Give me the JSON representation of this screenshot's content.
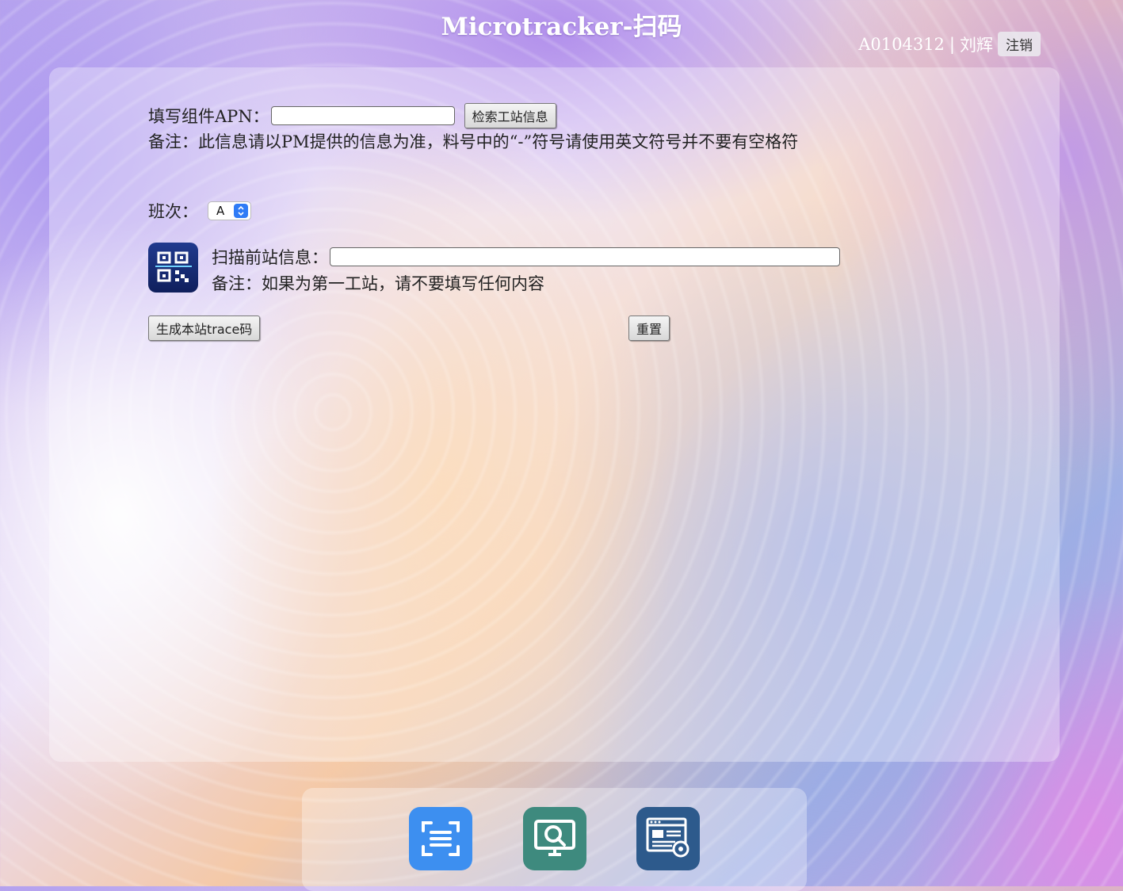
{
  "header": {
    "title": "Microtracker-扫码",
    "user_id": "A0104312",
    "separator": "|",
    "user_name": "刘辉",
    "logout_label": "注销"
  },
  "form": {
    "apn_label": "填写组件APN：",
    "apn_value": "",
    "search_button": "检索工站信息",
    "apn_note": "备注：此信息请以PM提供的信息为准，料号中的“-”符号请使用英文符号并不要有空格符",
    "shift_label": "班次：",
    "shift_value": "A",
    "scan_label": "扫描前站信息：",
    "scan_value": "",
    "scan_note": "备注：如果为第一工站，请不要填写任何内容",
    "generate_button": "生成本站trace码",
    "reset_button": "重置"
  },
  "dock": {
    "apps": [
      {
        "icon": "scan-icon",
        "color": "#3d8ff0"
      },
      {
        "icon": "monitor-search-icon",
        "color": "#3e8a7e"
      },
      {
        "icon": "settings-window-icon",
        "color": "#2d5a8c"
      }
    ]
  }
}
